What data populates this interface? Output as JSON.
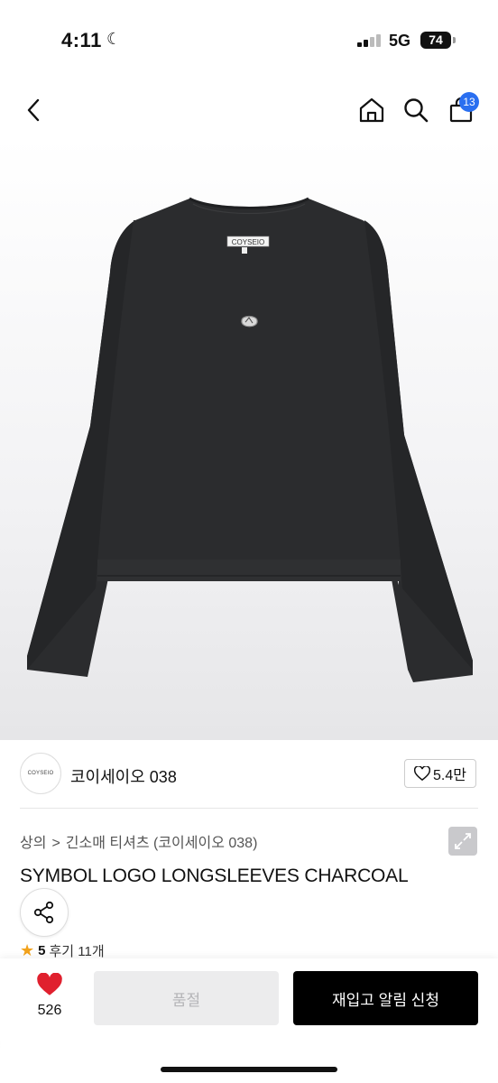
{
  "status_bar": {
    "time": "4:11",
    "network": "5G",
    "battery": "74"
  },
  "nav": {
    "cart_count": "13"
  },
  "product": {
    "label_text": "COYSEIO",
    "seller_logo_text": "COYSEIO",
    "seller_name": "코이세이오 038",
    "likes": "5.4만",
    "breadcrumb": {
      "category": "상의",
      "separator": ">",
      "subcategory": "긴소매 티셔츠 (코이세이오 038)"
    },
    "title": "SYMBOL LOGO LONGSLEEVES CHARCOAL",
    "rating": {
      "score": "5",
      "reviews": "후기 11개"
    }
  },
  "bottom_bar": {
    "wishlist_count": "526",
    "sold_out_label": "품절",
    "restock_label": "재입고 알림 신청"
  },
  "colors": {
    "accent_blue": "#2a6ff0",
    "heart_red": "#e0202e",
    "star_orange": "#f2a21b",
    "shirt_charcoal": "#2b2c2e"
  }
}
